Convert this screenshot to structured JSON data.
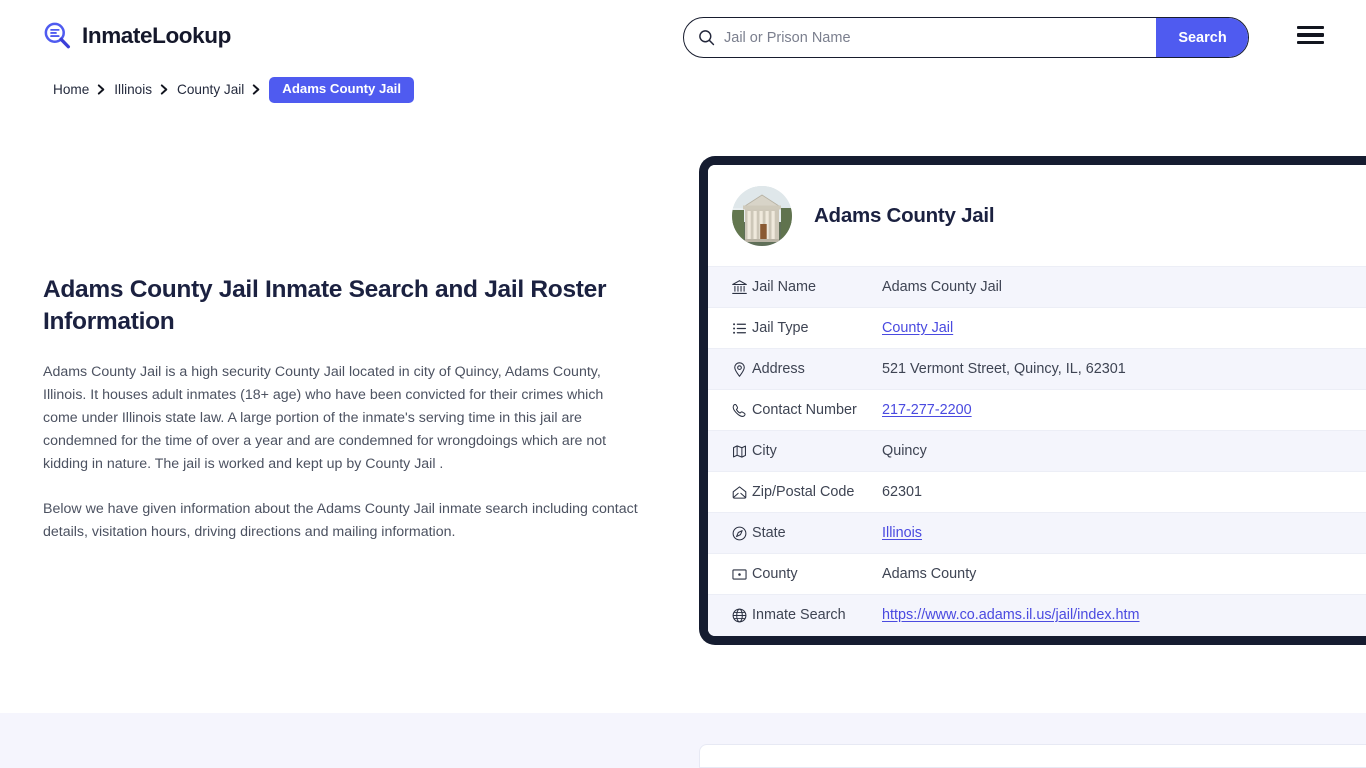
{
  "site": {
    "brand_name": "InmateLookup",
    "brand_icon": "magnifier-list-icon"
  },
  "search": {
    "placeholder": "Jail or Prison Name",
    "value": "",
    "button_label": "Search",
    "icon": "search-icon"
  },
  "menu": {
    "icon": "hamburger-menu-icon"
  },
  "breadcrumb": {
    "items": [
      {
        "label": "Home",
        "current": false
      },
      {
        "label": "Illinois",
        "current": false
      },
      {
        "label": "County Jail",
        "current": false
      },
      {
        "label": "Adams County Jail",
        "current": true
      }
    ],
    "separator_icon": "chevron-right-icon"
  },
  "article": {
    "title": "Adams County Jail Inmate Search and Jail Roster Information",
    "paragraphs": [
      "Adams County Jail is a high security County Jail located in city of Quincy, Adams County, Illinois. It houses adult inmates (18+ age) who have been convicted for their crimes which come under Illinois state law. A large portion of the inmate's serving time in this jail are condemned for the time of over a year and are condemned for wrongdoings which are not kidding in nature. The jail is worked and kept up by County Jail .",
      "Below we have given information about the Adams County Jail inmate search including contact details, visitation hours, driving directions and mailing information."
    ]
  },
  "info_card": {
    "title": "Adams County Jail",
    "thumbnail_icon": "courthouse-building-photo",
    "rows": [
      {
        "icon": "bank-icon",
        "label": "Jail Name",
        "value": "Adams County Jail",
        "is_link": false
      },
      {
        "icon": "list-icon",
        "label": "Jail Type",
        "value": "County Jail",
        "is_link": true
      },
      {
        "icon": "map-pin-icon",
        "label": "Address",
        "value": "521 Vermont Street, Quincy, IL, 62301",
        "is_link": false
      },
      {
        "icon": "phone-icon",
        "label": "Contact Number",
        "value": "217-277-2200",
        "is_link": true
      },
      {
        "icon": "map-icon",
        "label": "City",
        "value": "Quincy",
        "is_link": false
      },
      {
        "icon": "envelope-icon",
        "label": "Zip/Postal Code",
        "value": "62301",
        "is_link": false
      },
      {
        "icon": "compass-icon",
        "label": "State",
        "value": "Illinois",
        "is_link": true
      },
      {
        "icon": "county-map-icon",
        "label": "County",
        "value": "Adams County",
        "is_link": false
      },
      {
        "icon": "globe-icon",
        "label": "Inmate Search",
        "value": "https://www.co.adams.il.us/jail/index.htm",
        "is_link": true
      }
    ]
  },
  "colors": {
    "accent": "#4f5bf0",
    "link": "#4a4ae0",
    "card_border": "#151c30",
    "row_alt": "#f4f5fc",
    "band": "#f5f5fd",
    "heading": "#1b2140",
    "body_text": "#4c5261"
  }
}
